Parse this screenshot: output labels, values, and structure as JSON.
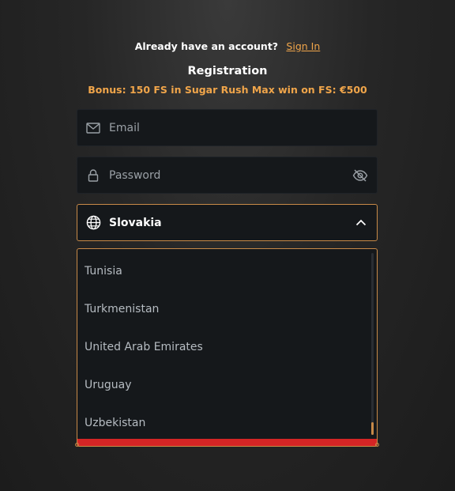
{
  "header": {
    "login_prompt": "Already have an account?",
    "sign_in_label": "Sign In",
    "title": "Registration",
    "bonus_text": "Bonus: 150 FS in Sugar Rush Max win on FS: €500"
  },
  "form": {
    "email": {
      "placeholder": "Email",
      "value": ""
    },
    "password": {
      "placeholder": "Password",
      "value": ""
    },
    "country": {
      "selected": "Slovakia",
      "expanded": true
    }
  },
  "country_options": [
    "Tunisia",
    "Turkmenistan",
    "United Arab Emirates",
    "Uruguay",
    "Uzbekistan"
  ],
  "colors": {
    "accent": "#f0a54a",
    "field_bg": "#15181b",
    "border_active": "#c88a48",
    "danger_bar": "#d42525"
  },
  "icons": {
    "email": "mail-icon",
    "password": "lock-icon",
    "visibility": "eye-off-icon",
    "country": "globe-icon",
    "dropdown": "chevron-up-icon"
  }
}
